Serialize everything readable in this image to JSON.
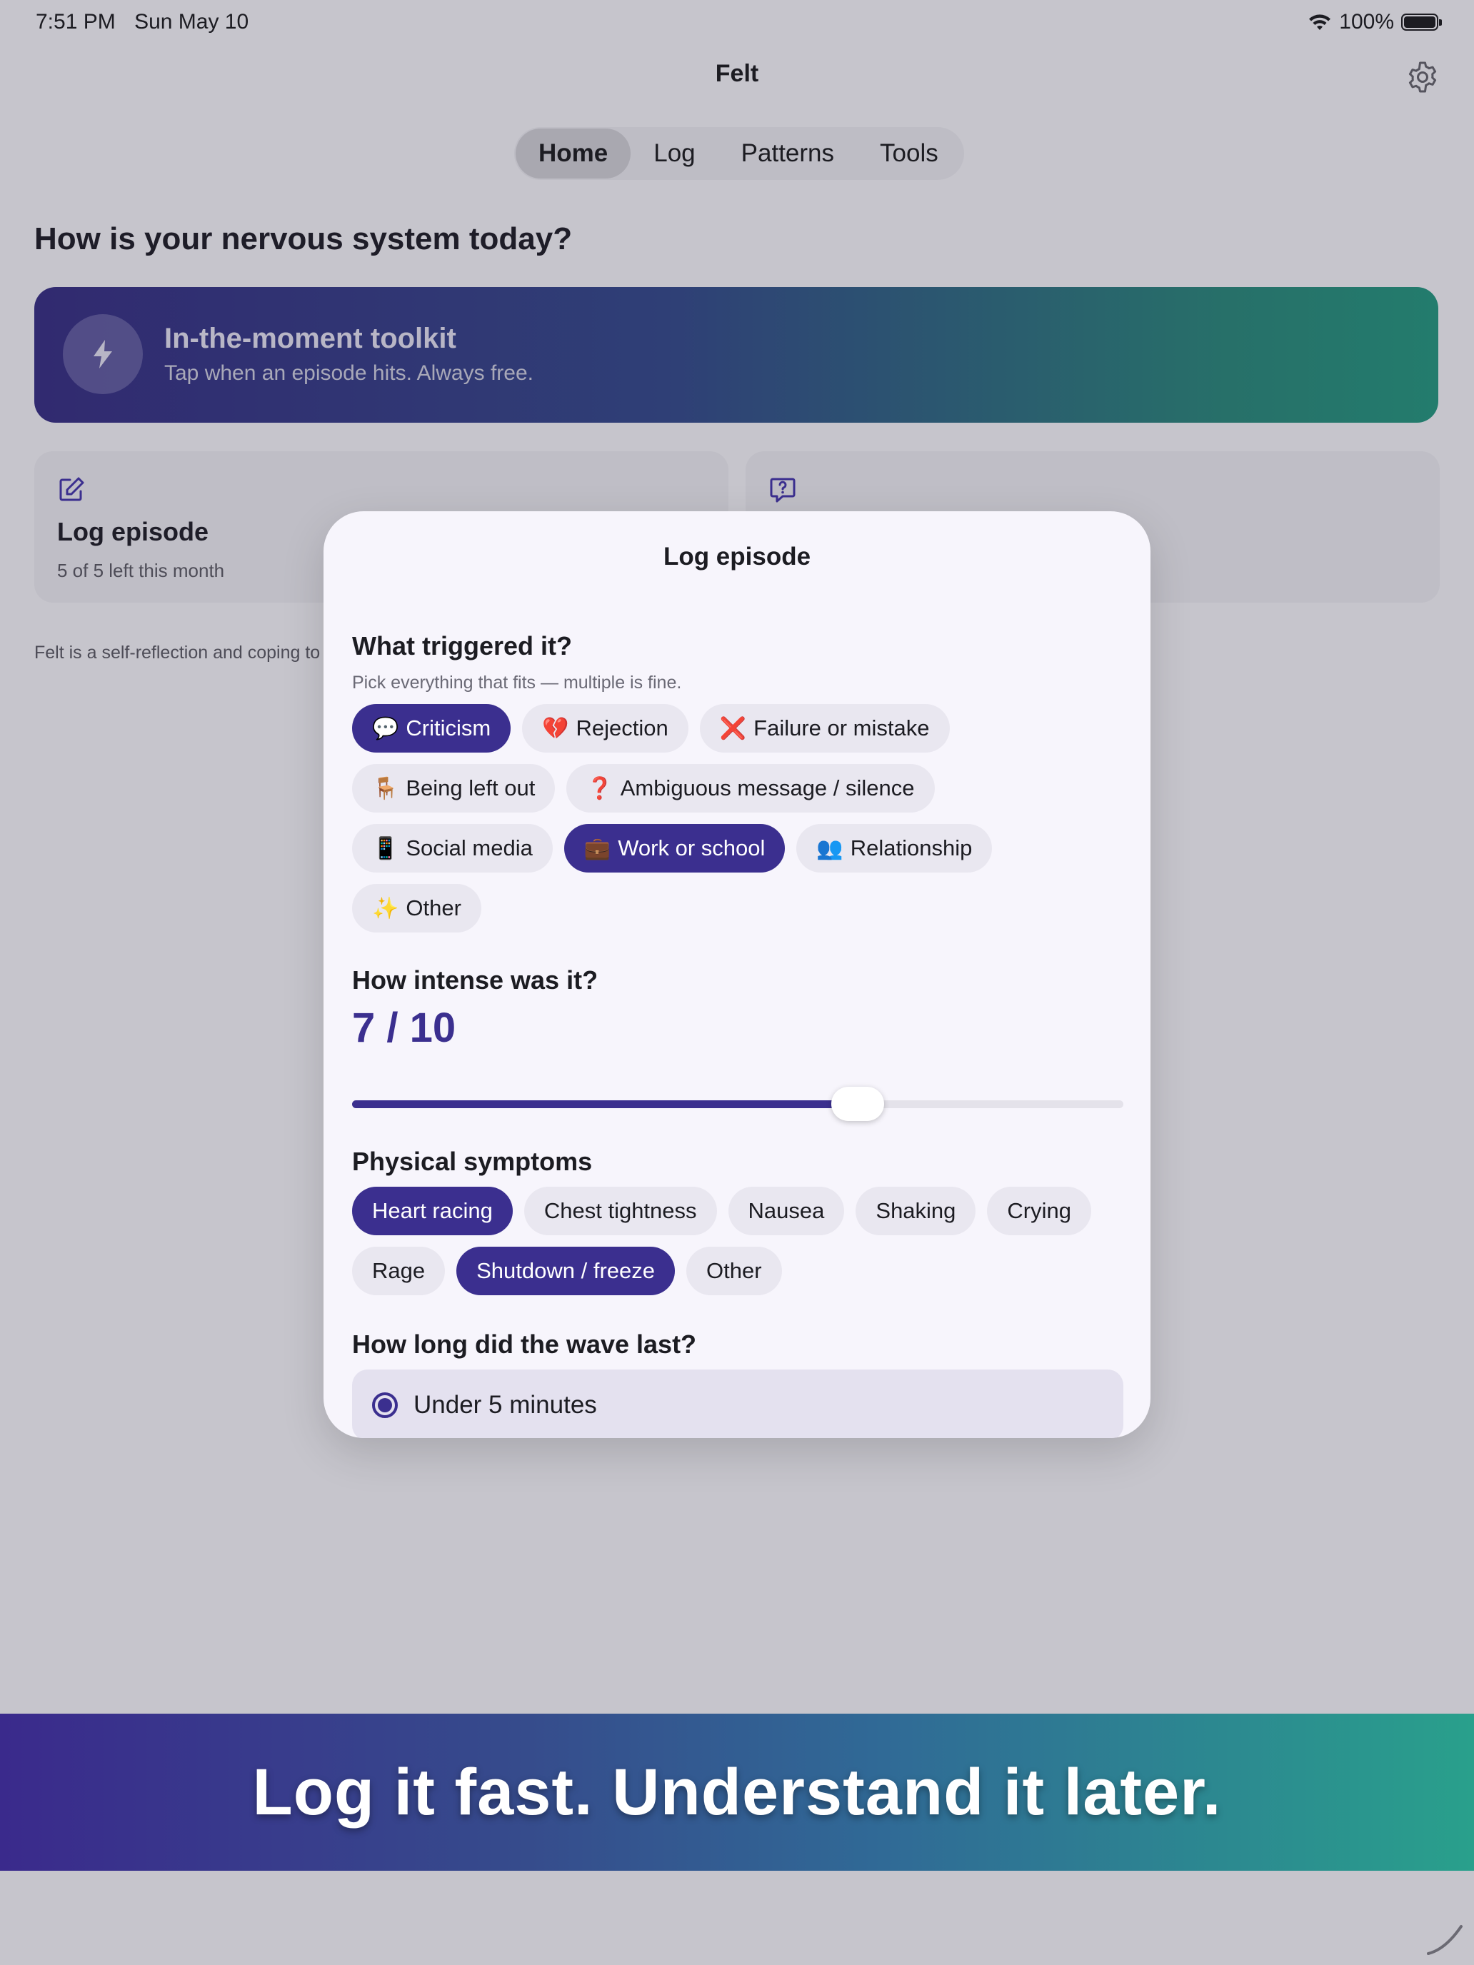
{
  "status_bar": {
    "time": "7:51 PM",
    "date": "Sun May 10",
    "battery": "100%"
  },
  "header": {
    "title": "Felt"
  },
  "tabs": [
    {
      "label": "Home",
      "active": true
    },
    {
      "label": "Log",
      "active": false
    },
    {
      "label": "Patterns",
      "active": false
    },
    {
      "label": "Tools",
      "active": false
    }
  ],
  "home": {
    "heading": "How is your nervous system today?",
    "toolkit": {
      "title": "In-the-moment toolkit",
      "subtitle": "Tap when an episode hits. Always free."
    },
    "log_card": {
      "title": "Log episode",
      "subtitle": "5 of 5 left this month"
    },
    "disclaimer": "Felt is a self-reflection and coping to"
  },
  "modal": {
    "title": "Log episode",
    "triggers": {
      "label": "What triggered it?",
      "hint": "Pick everything that fits — multiple is fine.",
      "items": [
        {
          "emoji": "💬",
          "label": "Criticism",
          "selected": true
        },
        {
          "emoji": "💔",
          "label": "Rejection",
          "selected": false
        },
        {
          "emoji": "❌",
          "label": "Failure or mistake",
          "selected": false
        },
        {
          "emoji": "🪑",
          "label": "Being left out",
          "selected": false
        },
        {
          "emoji": "❓",
          "label": "Ambiguous message / silence",
          "selected": false
        },
        {
          "emoji": "📱",
          "label": "Social media",
          "selected": false
        },
        {
          "emoji": "💼",
          "label": "Work or school",
          "selected": true
        },
        {
          "emoji": "👥",
          "label": "Relationship",
          "selected": false
        },
        {
          "emoji": "✨",
          "label": "Other",
          "selected": false
        }
      ]
    },
    "intensity": {
      "label": "How intense was it?",
      "value_text": "7 / 10",
      "value": 7,
      "max": 10
    },
    "symptoms": {
      "label": "Physical symptoms",
      "items": [
        {
          "label": "Heart racing",
          "selected": true
        },
        {
          "label": "Chest tightness",
          "selected": false
        },
        {
          "label": "Nausea",
          "selected": false
        },
        {
          "label": "Shaking",
          "selected": false
        },
        {
          "label": "Crying",
          "selected": false
        },
        {
          "label": "Rage",
          "selected": false
        },
        {
          "label": "Shutdown / freeze",
          "selected": true
        },
        {
          "label": "Other",
          "selected": false
        }
      ]
    },
    "duration": {
      "label": "How long did the wave last?",
      "selected_option": "Under 5 minutes"
    }
  },
  "banner": {
    "text": "Log it fast. Understand it later."
  },
  "colors": {
    "accent": "#3b2f8f",
    "teal": "#237c6d",
    "background": "#c6c5cc"
  }
}
